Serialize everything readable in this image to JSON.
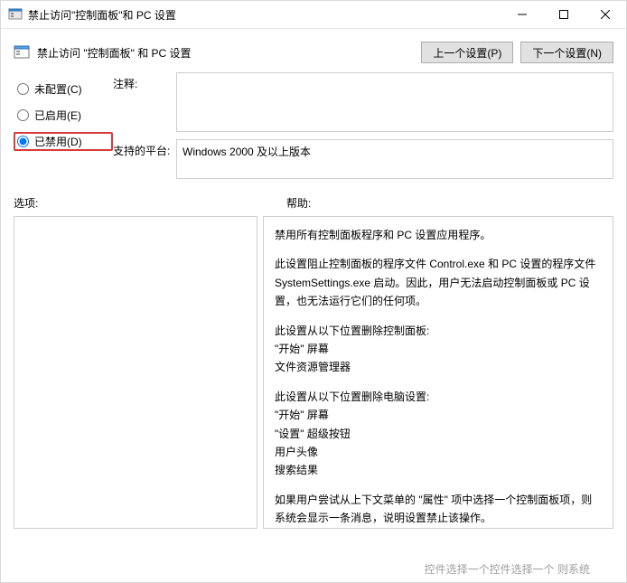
{
  "window": {
    "title": "禁止访问\"控制面板\"和 PC 设置"
  },
  "header": {
    "policy_title": "禁止访问 \"控制面板\" 和 PC 设置",
    "prev_button": "上一个设置(P)",
    "next_button": "下一个设置(N)"
  },
  "radios": {
    "not_configured": "未配置(C)",
    "enabled": "已启用(E)",
    "disabled": "已禁用(D)",
    "selected": "disabled"
  },
  "labels": {
    "comment": "注释:",
    "supported": "支持的平台:",
    "options": "选项:",
    "help": "帮助:"
  },
  "comment_value": "",
  "supported_value": "Windows 2000 及以上版本",
  "help_paragraphs": [
    "禁用所有控制面板程序和 PC 设置应用程序。",
    "此设置阻止控制面板的程序文件 Control.exe 和 PC 设置的程序文件 SystemSettings.exe 启动。因此，用户无法启动控制面板或 PC 设置，也无法运行它们的任何项。",
    "此设置从以下位置删除控制面板:\n \"开始\" 屏幕\n 文件资源管理器",
    "此设置从以下位置删除电脑设置:\n \"开始\" 屏幕\n \"设置\" 超级按钮\n 用户头像\n 搜索结果",
    "如果用户尝试从上下文菜单的 \"属性\" 项中选择一个控制面板项，则系统会显示一条消息，说明设置禁止该操作。"
  ],
  "artifact": "控件选择一个控件选择一个 则系统"
}
